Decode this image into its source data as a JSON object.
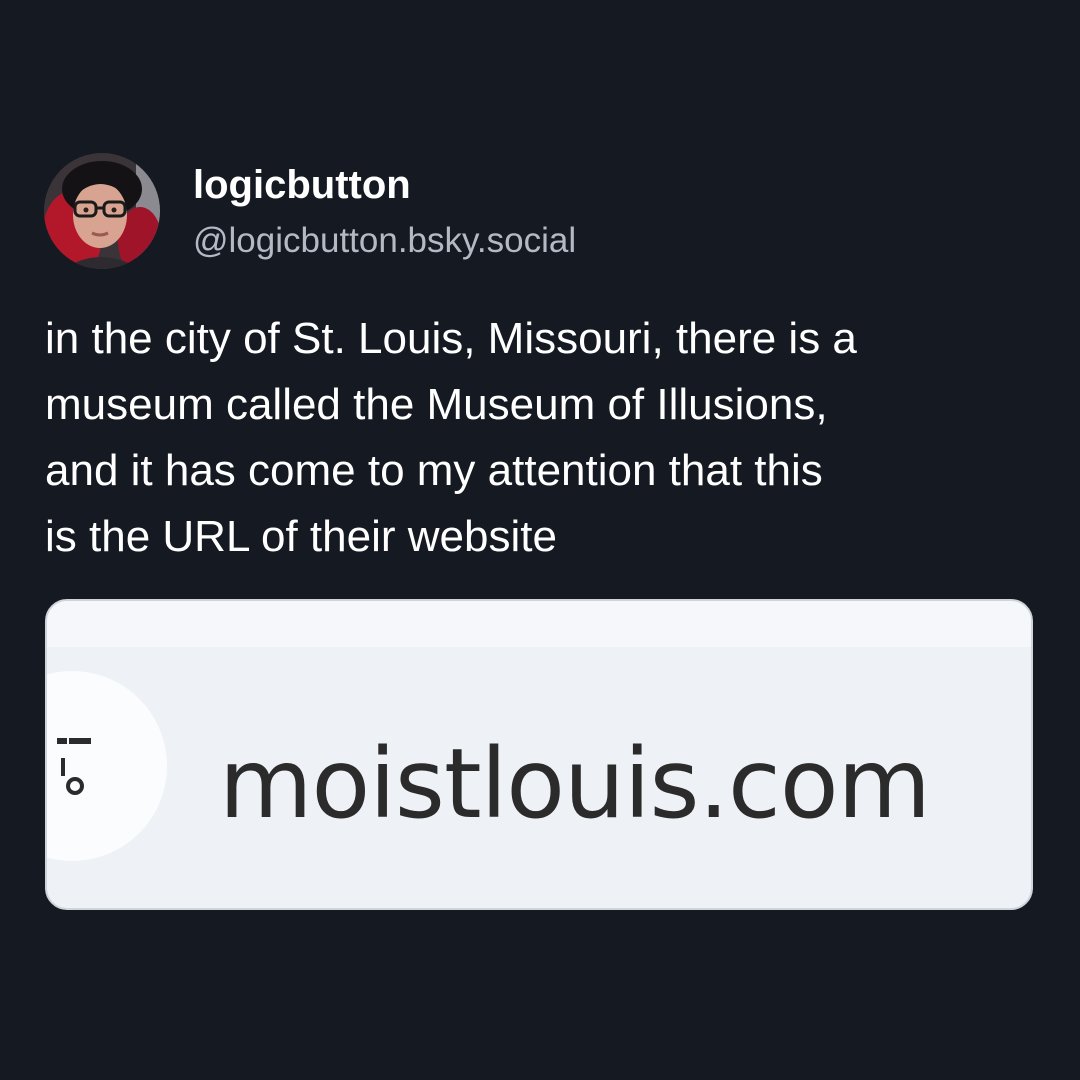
{
  "author": {
    "display_name": "logicbutton",
    "handle": "@logicbutton.bsky.social",
    "avatar_icon": "profile-photo"
  },
  "post": {
    "text": "in the city of St. Louis, Missouri, there is a\nmuseum called the Museum of Illusions,\nand it has come to my attention that this\nis the URL of their website"
  },
  "embed": {
    "url": "moistlouis.com",
    "site_icon": "tune-icon"
  },
  "colors": {
    "background": "#151922",
    "text": "#ffffff",
    "handle": "#b4bac4",
    "embed_background": "#eef1f6"
  }
}
